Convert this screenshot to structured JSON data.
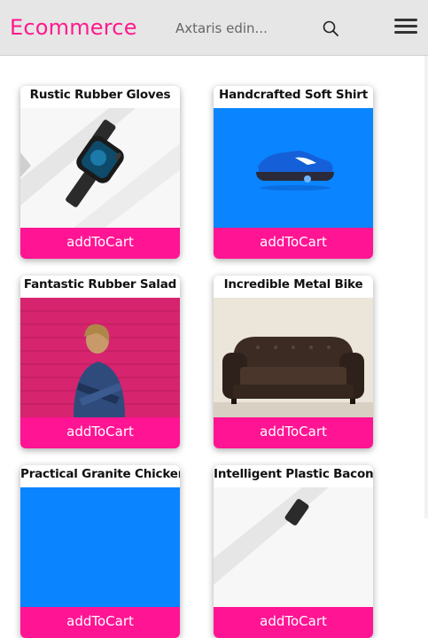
{
  "header": {
    "brand": "Ecommerce",
    "search_placeholder": "Axtaris edin..."
  },
  "products": [
    {
      "name": "Rustic Rubber Gloves",
      "image": "smartwatch",
      "button": "addToCart"
    },
    {
      "name": "Handcrafted Soft Shirt",
      "image": "blue-sneaker",
      "button": "addToCart"
    },
    {
      "name": "Fantastic Rubber Salad",
      "image": "woman-pink-wall",
      "button": "addToCart"
    },
    {
      "name": "Incredible Metal Bike",
      "image": "leather-sofa",
      "button": "addToCart"
    },
    {
      "name": "Practical Granite Chicken",
      "image": "blue-background",
      "button": "addToCart"
    },
    {
      "name": "Intelligent Plastic Bacon",
      "image": "smartwatch",
      "button": "addToCart"
    }
  ],
  "colors": {
    "accent": "#ff1493",
    "header_bg": "#e6e6e6",
    "sneaker_bg": "#0a84ff",
    "wall_pink": "#d6246e"
  }
}
